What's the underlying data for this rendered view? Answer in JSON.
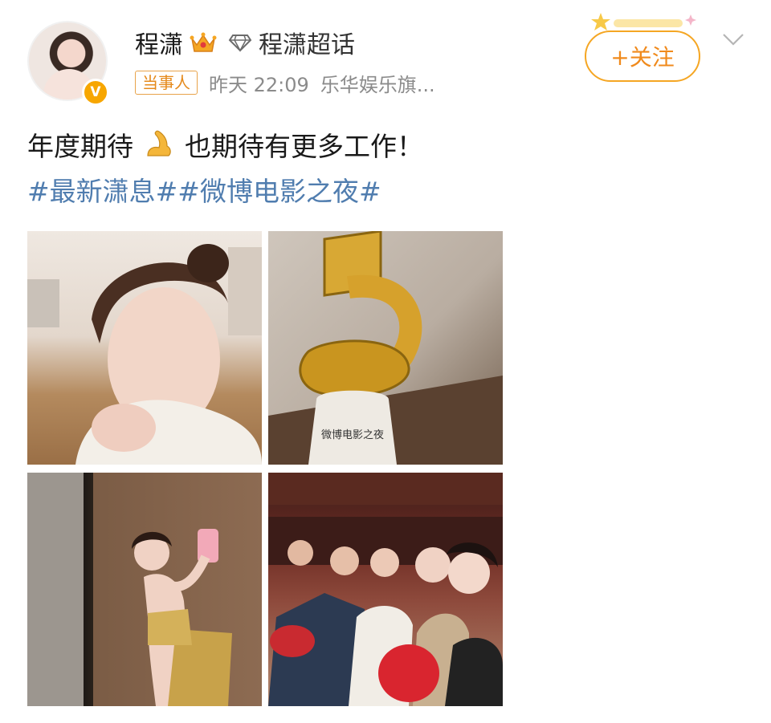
{
  "user": {
    "name": "程潇",
    "supertopic": "程潇超话",
    "role_tag": "当事人",
    "time": "昨天 22:09",
    "source": "乐华娱乐旗..."
  },
  "follow_button": {
    "label": "+关注"
  },
  "post": {
    "text_before": "年度期待",
    "text_after": "也期待有更多工作！",
    "hashtags": "#最新潇息##微博电影之夜#"
  },
  "photos": [
    {
      "name": "photo-portrait"
    },
    {
      "name": "photo-trophy",
      "trophy_text": "微博电影之夜"
    },
    {
      "name": "photo-mirror-selfie"
    },
    {
      "name": "photo-group-selfie"
    }
  ],
  "colors": {
    "accent_orange": "#f5a623",
    "link_blue": "#507daf",
    "meta_gray": "#8b8b8b"
  },
  "icons": [
    "crown-icon",
    "diamond-icon",
    "verified-badge-icon",
    "flexed-arm-icon",
    "chevron-down-icon",
    "star-sparkle-icon"
  ]
}
